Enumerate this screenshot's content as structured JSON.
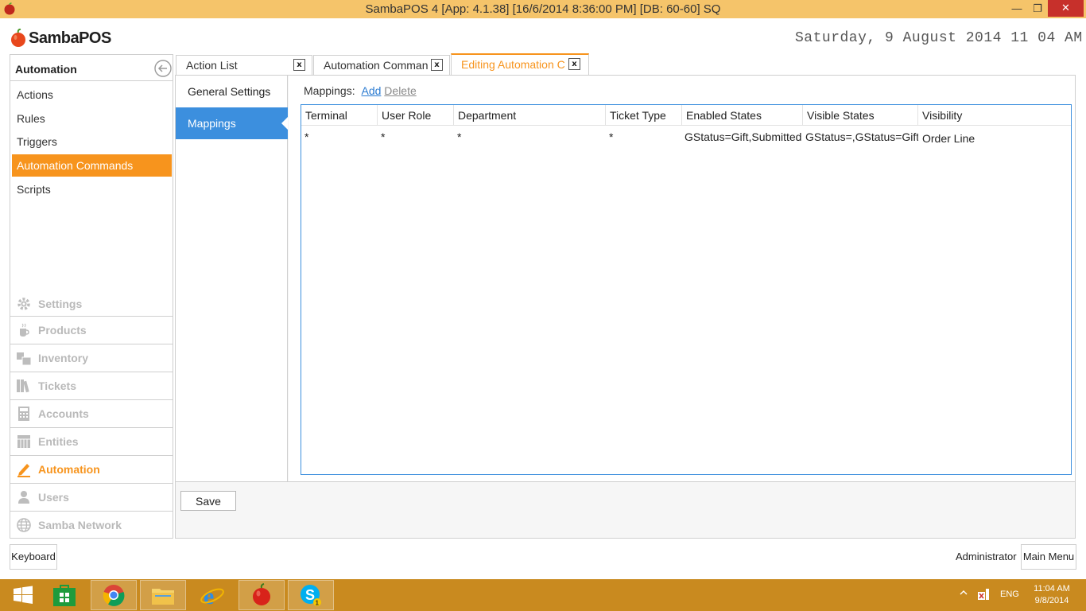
{
  "window": {
    "title": "SambaPOS 4 [App: 4.1.38] [16/6/2014 8:36:00 PM] [DB: 60-60] SQ",
    "min_glyph": "—",
    "max_glyph": "❐",
    "close_glyph": "✕"
  },
  "header": {
    "logo_text": "SambaPOS",
    "datetime": "Saturday, 9 August 2014 11 04 AM"
  },
  "sidebar": {
    "title": "Automation",
    "items": [
      {
        "label": "Actions"
      },
      {
        "label": "Rules"
      },
      {
        "label": "Triggers"
      },
      {
        "label": "Automation Commands"
      },
      {
        "label": "Scripts"
      }
    ],
    "categories": [
      {
        "label": "Settings",
        "icon": "gear-icon"
      },
      {
        "label": "Products",
        "icon": "cup-icon"
      },
      {
        "label": "Inventory",
        "icon": "boxes-icon"
      },
      {
        "label": "Tickets",
        "icon": "books-icon"
      },
      {
        "label": "Accounts",
        "icon": "calculator-icon"
      },
      {
        "label": "Entities",
        "icon": "table-icon"
      },
      {
        "label": "Automation",
        "icon": "pencil-icon"
      },
      {
        "label": "Users",
        "icon": "user-icon"
      },
      {
        "label": "Samba Network",
        "icon": "globe-icon"
      }
    ]
  },
  "tabs": [
    {
      "label": "Action List",
      "close": "x"
    },
    {
      "label": "Automation Comman",
      "close": "x"
    },
    {
      "label": "Editing Automation C",
      "close": "x"
    }
  ],
  "editor": {
    "nav": [
      {
        "label": "General Settings"
      },
      {
        "label": "Mappings"
      }
    ],
    "mappings_label": "Mappings:",
    "add_label": "Add",
    "delete_label": "Delete",
    "columns": [
      "Terminal",
      "User Role",
      "Department",
      "Ticket Type",
      "Enabled States",
      "Visible States",
      "Visibility"
    ],
    "rows": [
      [
        "*",
        "*",
        "*",
        "*",
        "GStatus=Gift,Submitted",
        "GStatus=,GStatus=Gift",
        "Order Line"
      ]
    ],
    "save_label": "Save"
  },
  "bottom": {
    "keyboard_label": "Keyboard",
    "user_label": "Administrator",
    "main_menu_label": "Main Menu"
  },
  "taskbar": {
    "lang": "ENG",
    "time": "11:04 AM",
    "date": "9/8/2014",
    "skype_badge": "1"
  },
  "colors": {
    "accent_orange": "#f7941d",
    "selection_blue": "#3c8fde",
    "titlebar": "#f5c46a",
    "taskbar": "#c98a1f",
    "close_red": "#c7302b"
  }
}
